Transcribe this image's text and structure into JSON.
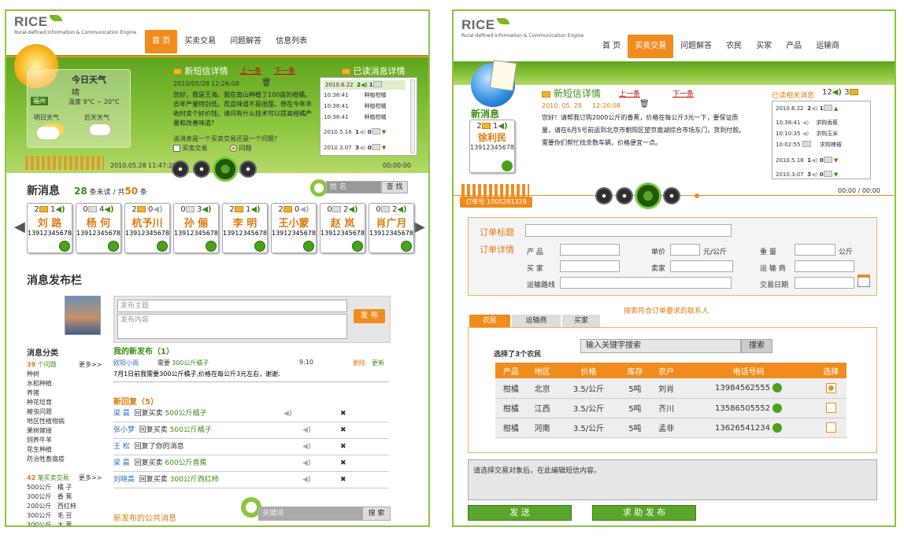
{
  "left": {
    "logo": "RICE",
    "logo_sub": "Rural-defined Information & Communication Engine",
    "nav": [
      "首 页",
      "买卖交易",
      "问题解答",
      "信息列表"
    ],
    "weather": {
      "title": "今日天气",
      "desc": "晴",
      "city": "福州",
      "temp": "温度 9°C ~ 20°C",
      "d1": "明日天气",
      "d2": "后天天气"
    },
    "sms": {
      "title": "新短信详情",
      "prev": "上一条",
      "next": "下一条",
      "date": "2010/05/28",
      "time": "12:26:08",
      "body": "您好，我是王海。我在南山种植了100亩的柑橘。去年产量特别低。而且味道不是很甜。想在今年丰收时卖个好价钱，请问有什么技术可以提高柑橘产量和改善味道?",
      "question": "该消息是一个买卖交易还是一个问题？",
      "opt1": "买卖交易",
      "opt2": "问题"
    },
    "read": {
      "title": "已读消息详情",
      "rows": [
        {
          "date": "2010.6.22",
          "n1": "2",
          "n2": "1"
        },
        {
          "time": "10:38:41",
          "txt": "种植柑橘"
        },
        {
          "time": "10:38:41",
          "txt": "种植柑橘"
        },
        {
          "time": "10:38:41",
          "txt": "种植柑橘"
        },
        {
          "date": "2010.5.18",
          "n1": "1",
          "n2": "0"
        },
        {
          "date": "2010.3.07",
          "n1": "3",
          "n2": "0"
        }
      ]
    },
    "player": {
      "date": "2010.05.28",
      "time": "11:47:20",
      "counter": "00:00:00"
    },
    "news": {
      "title": "新消息",
      "unread": "28",
      "unread_lbl": "条未读 / 共",
      "total": "50",
      "total_lbl": "条",
      "search_ph": "姓 名",
      "search_btn": "查 找"
    },
    "cards": [
      {
        "a": "2",
        "b": "1",
        "name": "刘 路",
        "phone": "13912345678"
      },
      {
        "a": "0",
        "b": "4",
        "name": "杨 何",
        "phone": "13912345678"
      },
      {
        "a": "2",
        "b": "0",
        "name": "杭予川",
        "phone": "13912345678"
      },
      {
        "a": "0",
        "b": "3",
        "name": "孙 俪",
        "phone": "13912345678"
      },
      {
        "a": "2",
        "b": "1",
        "name": "李 明",
        "phone": "13912345678"
      },
      {
        "a": "2",
        "b": "0",
        "name": "王小蒙",
        "phone": "13912345678"
      },
      {
        "a": "0",
        "b": "2",
        "name": "赵 岚",
        "phone": "13912345678"
      },
      {
        "a": "0",
        "b": "2",
        "name": "肖广月",
        "phone": "13912345678"
      }
    ],
    "publish": {
      "title": "消息发布栏",
      "topic_ph": "发布主题",
      "content_ph": "发布内容",
      "btn": "发 布"
    },
    "cat": {
      "title": "消息分类",
      "count": "39",
      "count_lbl": "个问题",
      "more": "更多>>",
      "items": [
        "种树",
        "水稻种植",
        "养猪",
        "种花培育",
        "蝗虫问题",
        "地区性植物病",
        "果树嫁接",
        "饲养牛羊",
        "花生种植",
        "防治牲畜瘟疫"
      ],
      "count2": "42",
      "count2_lbl": "笔买卖交易",
      "more2": "更多>>",
      "trade": [
        [
          "500公斤",
          "橘 子"
        ],
        [
          "300公斤",
          "香 蕉"
        ],
        [
          "200公斤",
          "西红柿"
        ],
        [
          "300公斤",
          "毛 豆"
        ],
        [
          "300公斤",
          "大 葱"
        ]
      ]
    },
    "mine": {
      "title": "我的新发布（1）",
      "user": "欧阳小雨",
      "need": "需要",
      "item": "300公斤橘子",
      "time": "9:10",
      "del": "删除",
      "upd": "更新",
      "text": "7月1日前我需要300公斤橘子,价格在每公斤3元左右，谢谢."
    },
    "reply": {
      "title": "新回复（5）",
      "rows": [
        {
          "u": "梁 晨",
          "a": "回复买卖",
          "i": "500公斤橘子"
        },
        {
          "u": "张小梦",
          "a": "回复买卖",
          "i": "500公斤橘子"
        },
        {
          "u": "王 松",
          "a": "回复了你的消息",
          "i": ""
        },
        {
          "u": "梁 晨",
          "a": "回复买卖",
          "i": "600公斤香蕉"
        },
        {
          "u": "刘晓高",
          "a": "回复买卖",
          "i": "300公斤西红柿"
        }
      ]
    },
    "pub": {
      "title": "新发布的公共消息",
      "ph": "关键词",
      "btn": "搜 索"
    }
  },
  "right": {
    "logo": "RICE",
    "logo_sub": "Rural-defined Information & Communication Engine",
    "nav": [
      "首 页",
      "买卖交易",
      "问题解答",
      "农民",
      "买家",
      "产品",
      "运输商"
    ],
    "newmsg": {
      "title": "新消息",
      "n1": "2",
      "n2": "1",
      "name": "徐利民",
      "phone": "13912345678"
    },
    "sms": {
      "title": "新短信详情",
      "prev": "上一条",
      "next": "下一条",
      "date": "2010. 05. 28",
      "time": "12:26:08",
      "body": "您好！请帮我订购2000公斤的香蕉，价格在每公斤3元一下，要保证质量，请在6月5号前运到北京市朝阳区望京南湖综合市场东门，货到付款。需要你们帮忙找余数车辆，价格便宜一点。"
    },
    "read": {
      "title": "已读相关消息",
      "n1": "12",
      "n2": "3",
      "rows": [
        {
          "date": "2010.6.22",
          "n1": "2",
          "n2": "1"
        },
        {
          "time": "10:38:41",
          "txt": "求购香蕉"
        },
        {
          "time": "10:10:35",
          "txt": "求购玉米"
        },
        {
          "time": "10:02:55",
          "txt": "求购辣椒"
        },
        {
          "date": "2010.5.18",
          "n1": "1",
          "n2": "0"
        },
        {
          "date": "2010.3.07",
          "n1": "3",
          "n2": "0"
        }
      ]
    },
    "order_no": "订单号 1005281329",
    "counter": "00:00 / 00:00",
    "order": {
      "t1": "订单标题",
      "t2": "订单详情",
      "product": "产 品",
      "price": "单价",
      "unit": "元/公斤",
      "weight": "重 量",
      "kg": "公斤",
      "buyer": "买 家",
      "seller": "卖家",
      "carrier": "运 输 商",
      "route": "运输路线",
      "date": "交易日期"
    },
    "search_title": "搜索符合订单要求的联系人",
    "tabs": [
      "农民",
      "运输商",
      "买家"
    ],
    "sel": "选择了3个农民",
    "kw_ph": "输入关键字搜索",
    "kw_btn": "搜索",
    "table": {
      "head": [
        "产品",
        "地区",
        "价格",
        "库存",
        "农户",
        "电话号码",
        "选择"
      ],
      "rows": [
        [
          "柑橘",
          "北京",
          "3.5/公斤",
          "5吨",
          "刘肖",
          "13984562555"
        ],
        [
          "柑橘",
          "江西",
          "3.5/公斤",
          "5吨",
          "齐川",
          "13586505552"
        ],
        [
          "柑橘",
          "河南",
          "3.5/公斤",
          "5吨",
          "孟非",
          "13626541234"
        ]
      ]
    },
    "msg_ph": "请选择交易对象后，在此编辑短信内容。",
    "send": "发 送",
    "help": "求 助 发 布"
  },
  "colors": {
    "accent": "#f08c1e",
    "green": "#8cc63f"
  }
}
